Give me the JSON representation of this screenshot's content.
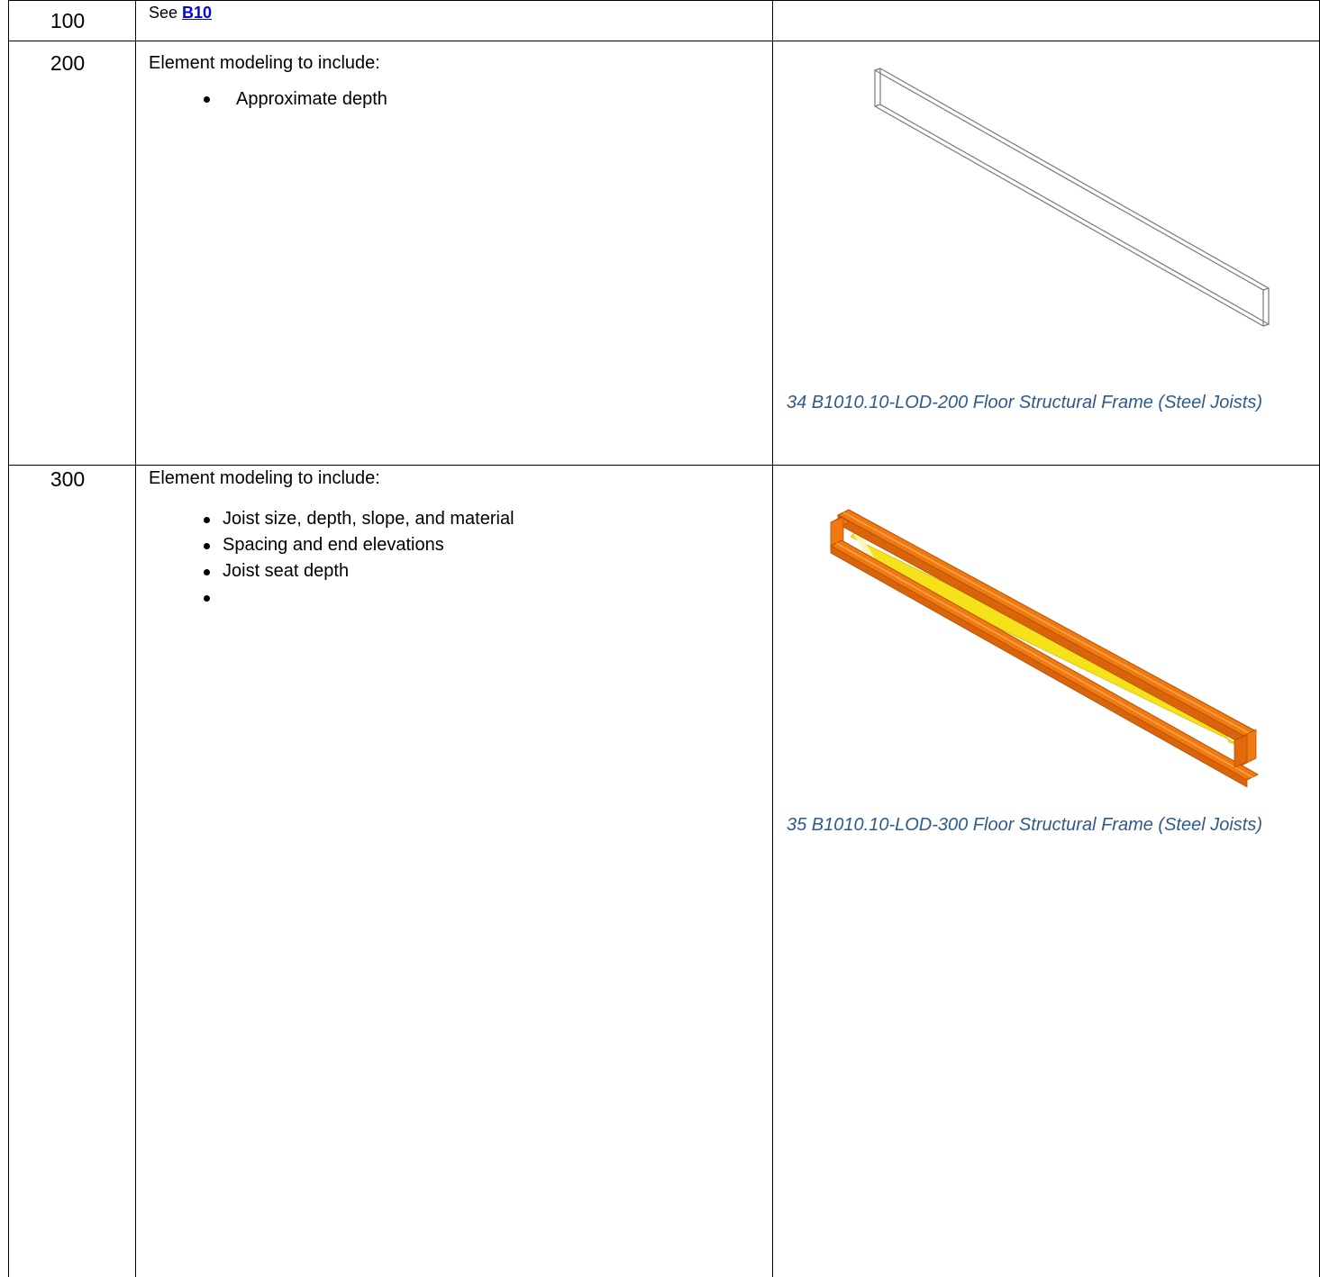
{
  "rows": [
    {
      "lod": "100",
      "desc_prefix": "See ",
      "link_text": "B10"
    },
    {
      "lod": "200",
      "intro": "Element modeling to include:",
      "bullets": [
        "Approximate depth"
      ],
      "caption": "34 B1010.10-LOD-200 Floor Structural Frame (Steel Joists)"
    },
    {
      "lod": "300",
      "intro": "Element modeling to include:",
      "bullets": [
        "Joist size, depth, slope, and material",
        "Spacing and end elevations",
        "Joist seat depth",
        ""
      ],
      "caption": "35 B1010.10-LOD-300 Floor Structural Frame (Steel Joists)"
    }
  ],
  "colors": {
    "caption": "#2e5a8c",
    "link": "#0000ee",
    "joist_chord": "#f07a10",
    "joist_web": "#f5e21a"
  }
}
